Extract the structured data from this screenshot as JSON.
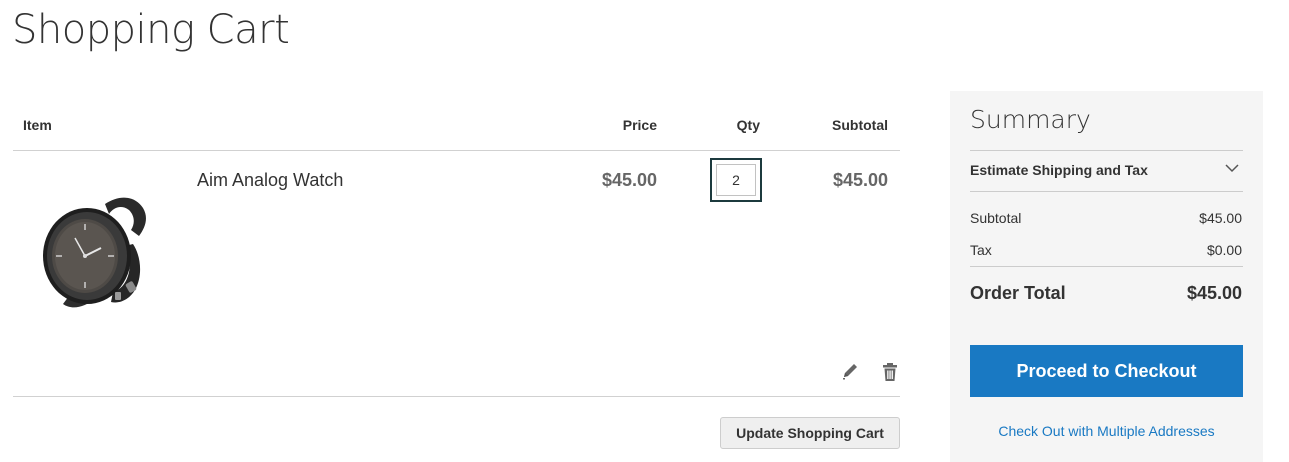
{
  "page": {
    "title": "Shopping Cart"
  },
  "cart": {
    "columns": {
      "item": "Item",
      "price": "Price",
      "qty": "Qty",
      "subtotal": "Subtotal"
    },
    "items": [
      {
        "name": "Aim Analog Watch",
        "price": "$45.00",
        "qty": "2",
        "subtotal": "$45.00",
        "image_icon": "analog-watch-image"
      }
    ],
    "actions": {
      "edit_icon": "pencil-icon",
      "delete_icon": "trash-icon"
    },
    "update_button_label": "Update Shopping Cart"
  },
  "summary": {
    "title": "Summary",
    "estimate_label": "Estimate Shipping and Tax",
    "subtotal_label": "Subtotal",
    "subtotal_value": "$45.00",
    "tax_label": "Tax",
    "tax_value": "$0.00",
    "order_total_label": "Order Total",
    "order_total_value": "$45.00",
    "checkout_button_label": "Proceed to Checkout",
    "multi_address_link": "Check Out with Multiple Addresses"
  },
  "colors": {
    "primary": "#1979c3",
    "summary_background": "#f5f5f5",
    "qty_focus_border": "#1c3a3e"
  }
}
